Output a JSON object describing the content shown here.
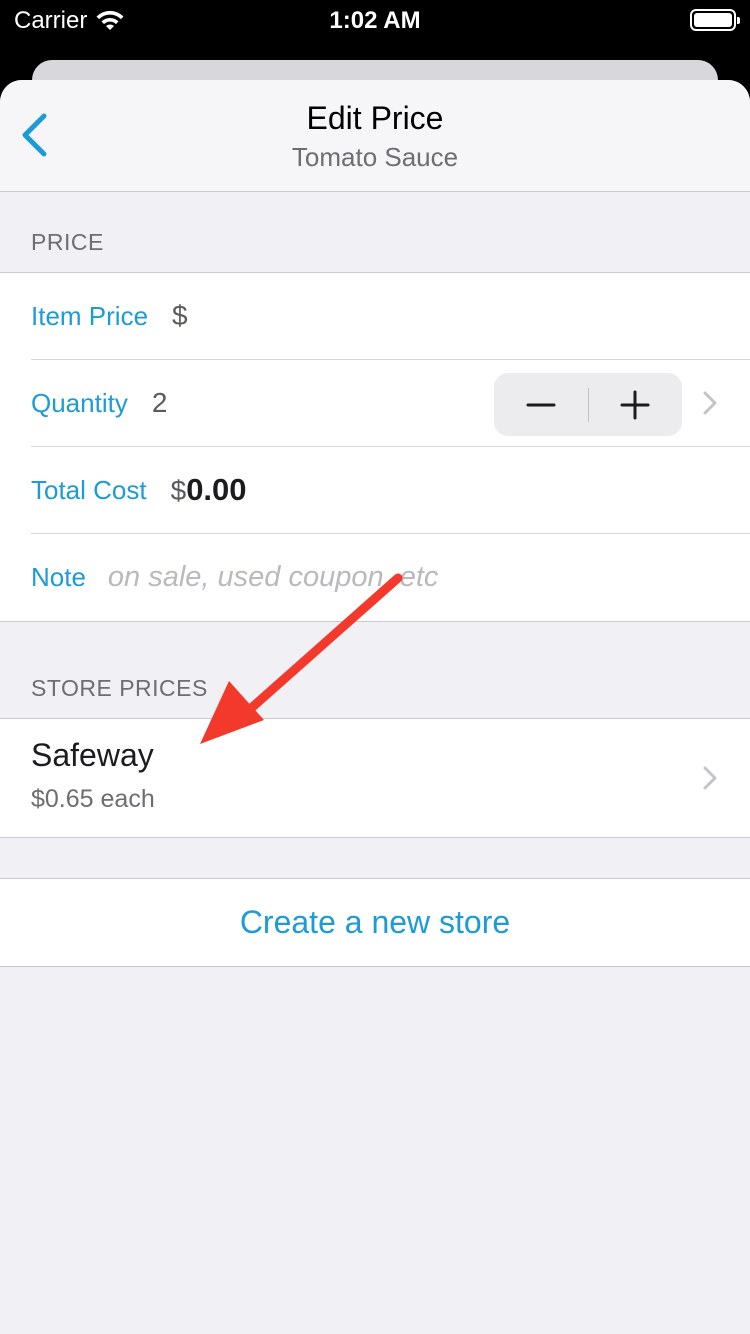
{
  "status_bar": {
    "carrier": "Carrier",
    "time": "1:02 AM"
  },
  "nav": {
    "title": "Edit Price",
    "subtitle": "Tomato Sauce"
  },
  "price_section": {
    "header": "PRICE",
    "item_price_label": "Item Price",
    "item_price_symbol": "$",
    "quantity_label": "Quantity",
    "quantity_value": "2",
    "total_cost_label": "Total Cost",
    "total_cost_symbol": "$",
    "total_cost_value": "0.00",
    "note_label": "Note",
    "note_placeholder": "on sale, used coupon, etc"
  },
  "store_prices_section": {
    "header": "STORE PRICES",
    "stores": [
      {
        "name": "Safeway",
        "price": "$0.65 each"
      }
    ]
  },
  "create_store": {
    "label": "Create a new store"
  },
  "colors": {
    "accent": "#1d9bd7",
    "annotation_arrow": "#f2392c"
  }
}
